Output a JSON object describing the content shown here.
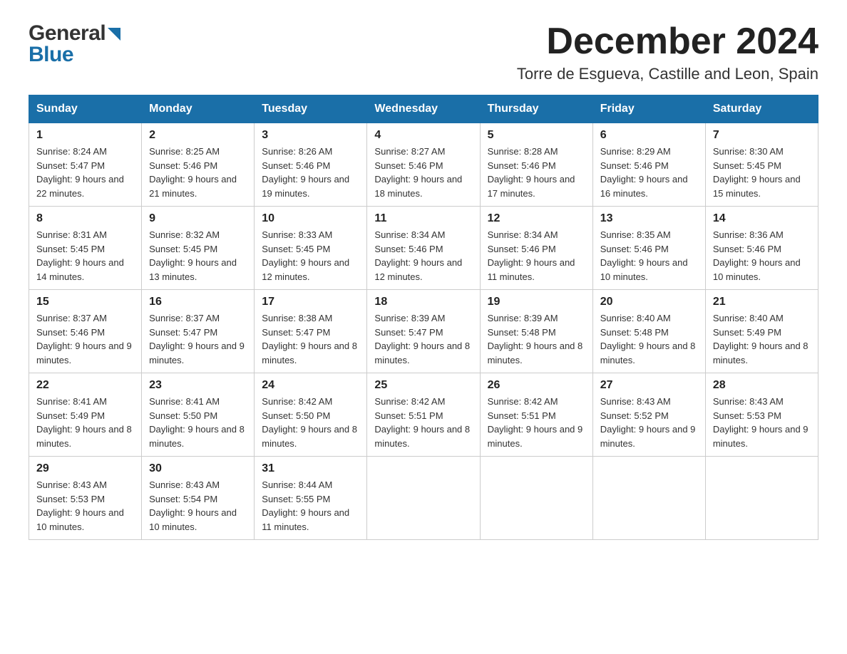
{
  "header": {
    "month_year": "December 2024",
    "location": "Torre de Esgueva, Castille and Leon, Spain"
  },
  "logo": {
    "general": "General",
    "blue": "Blue"
  },
  "days_of_week": [
    "Sunday",
    "Monday",
    "Tuesday",
    "Wednesday",
    "Thursday",
    "Friday",
    "Saturday"
  ],
  "weeks": [
    [
      {
        "day": "1",
        "sunrise": "Sunrise: 8:24 AM",
        "sunset": "Sunset: 5:47 PM",
        "daylight": "Daylight: 9 hours and 22 minutes."
      },
      {
        "day": "2",
        "sunrise": "Sunrise: 8:25 AM",
        "sunset": "Sunset: 5:46 PM",
        "daylight": "Daylight: 9 hours and 21 minutes."
      },
      {
        "day": "3",
        "sunrise": "Sunrise: 8:26 AM",
        "sunset": "Sunset: 5:46 PM",
        "daylight": "Daylight: 9 hours and 19 minutes."
      },
      {
        "day": "4",
        "sunrise": "Sunrise: 8:27 AM",
        "sunset": "Sunset: 5:46 PM",
        "daylight": "Daylight: 9 hours and 18 minutes."
      },
      {
        "day": "5",
        "sunrise": "Sunrise: 8:28 AM",
        "sunset": "Sunset: 5:46 PM",
        "daylight": "Daylight: 9 hours and 17 minutes."
      },
      {
        "day": "6",
        "sunrise": "Sunrise: 8:29 AM",
        "sunset": "Sunset: 5:46 PM",
        "daylight": "Daylight: 9 hours and 16 minutes."
      },
      {
        "day": "7",
        "sunrise": "Sunrise: 8:30 AM",
        "sunset": "Sunset: 5:45 PM",
        "daylight": "Daylight: 9 hours and 15 minutes."
      }
    ],
    [
      {
        "day": "8",
        "sunrise": "Sunrise: 8:31 AM",
        "sunset": "Sunset: 5:45 PM",
        "daylight": "Daylight: 9 hours and 14 minutes."
      },
      {
        "day": "9",
        "sunrise": "Sunrise: 8:32 AM",
        "sunset": "Sunset: 5:45 PM",
        "daylight": "Daylight: 9 hours and 13 minutes."
      },
      {
        "day": "10",
        "sunrise": "Sunrise: 8:33 AM",
        "sunset": "Sunset: 5:45 PM",
        "daylight": "Daylight: 9 hours and 12 minutes."
      },
      {
        "day": "11",
        "sunrise": "Sunrise: 8:34 AM",
        "sunset": "Sunset: 5:46 PM",
        "daylight": "Daylight: 9 hours and 12 minutes."
      },
      {
        "day": "12",
        "sunrise": "Sunrise: 8:34 AM",
        "sunset": "Sunset: 5:46 PM",
        "daylight": "Daylight: 9 hours and 11 minutes."
      },
      {
        "day": "13",
        "sunrise": "Sunrise: 8:35 AM",
        "sunset": "Sunset: 5:46 PM",
        "daylight": "Daylight: 9 hours and 10 minutes."
      },
      {
        "day": "14",
        "sunrise": "Sunrise: 8:36 AM",
        "sunset": "Sunset: 5:46 PM",
        "daylight": "Daylight: 9 hours and 10 minutes."
      }
    ],
    [
      {
        "day": "15",
        "sunrise": "Sunrise: 8:37 AM",
        "sunset": "Sunset: 5:46 PM",
        "daylight": "Daylight: 9 hours and 9 minutes."
      },
      {
        "day": "16",
        "sunrise": "Sunrise: 8:37 AM",
        "sunset": "Sunset: 5:47 PM",
        "daylight": "Daylight: 9 hours and 9 minutes."
      },
      {
        "day": "17",
        "sunrise": "Sunrise: 8:38 AM",
        "sunset": "Sunset: 5:47 PM",
        "daylight": "Daylight: 9 hours and 8 minutes."
      },
      {
        "day": "18",
        "sunrise": "Sunrise: 8:39 AM",
        "sunset": "Sunset: 5:47 PM",
        "daylight": "Daylight: 9 hours and 8 minutes."
      },
      {
        "day": "19",
        "sunrise": "Sunrise: 8:39 AM",
        "sunset": "Sunset: 5:48 PM",
        "daylight": "Daylight: 9 hours and 8 minutes."
      },
      {
        "day": "20",
        "sunrise": "Sunrise: 8:40 AM",
        "sunset": "Sunset: 5:48 PM",
        "daylight": "Daylight: 9 hours and 8 minutes."
      },
      {
        "day": "21",
        "sunrise": "Sunrise: 8:40 AM",
        "sunset": "Sunset: 5:49 PM",
        "daylight": "Daylight: 9 hours and 8 minutes."
      }
    ],
    [
      {
        "day": "22",
        "sunrise": "Sunrise: 8:41 AM",
        "sunset": "Sunset: 5:49 PM",
        "daylight": "Daylight: 9 hours and 8 minutes."
      },
      {
        "day": "23",
        "sunrise": "Sunrise: 8:41 AM",
        "sunset": "Sunset: 5:50 PM",
        "daylight": "Daylight: 9 hours and 8 minutes."
      },
      {
        "day": "24",
        "sunrise": "Sunrise: 8:42 AM",
        "sunset": "Sunset: 5:50 PM",
        "daylight": "Daylight: 9 hours and 8 minutes."
      },
      {
        "day": "25",
        "sunrise": "Sunrise: 8:42 AM",
        "sunset": "Sunset: 5:51 PM",
        "daylight": "Daylight: 9 hours and 8 minutes."
      },
      {
        "day": "26",
        "sunrise": "Sunrise: 8:42 AM",
        "sunset": "Sunset: 5:51 PM",
        "daylight": "Daylight: 9 hours and 9 minutes."
      },
      {
        "day": "27",
        "sunrise": "Sunrise: 8:43 AM",
        "sunset": "Sunset: 5:52 PM",
        "daylight": "Daylight: 9 hours and 9 minutes."
      },
      {
        "day": "28",
        "sunrise": "Sunrise: 8:43 AM",
        "sunset": "Sunset: 5:53 PM",
        "daylight": "Daylight: 9 hours and 9 minutes."
      }
    ],
    [
      {
        "day": "29",
        "sunrise": "Sunrise: 8:43 AM",
        "sunset": "Sunset: 5:53 PM",
        "daylight": "Daylight: 9 hours and 10 minutes."
      },
      {
        "day": "30",
        "sunrise": "Sunrise: 8:43 AM",
        "sunset": "Sunset: 5:54 PM",
        "daylight": "Daylight: 9 hours and 10 minutes."
      },
      {
        "day": "31",
        "sunrise": "Sunrise: 8:44 AM",
        "sunset": "Sunset: 5:55 PM",
        "daylight": "Daylight: 9 hours and 11 minutes."
      },
      null,
      null,
      null,
      null
    ]
  ]
}
